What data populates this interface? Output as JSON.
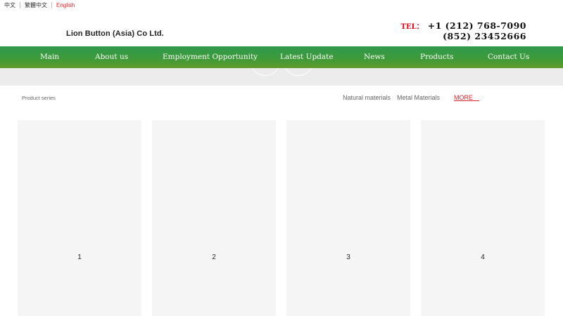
{
  "lang": {
    "items": [
      "中文",
      "繁體中文",
      "English"
    ]
  },
  "header": {
    "company": "Lion Button (Asia) Co Ltd.",
    "tel_label": "TEL：",
    "tel_1": "+1 (212) 768-7090",
    "tel_2": "(852) 23452666"
  },
  "nav": {
    "items": [
      "Main",
      "About us",
      "Employment Opportunity",
      "Latest Update",
      "News",
      "Products",
      "Contact Us"
    ]
  },
  "products": {
    "series_label": "Product series",
    "categories": [
      "Natural materials",
      "Metal Materials"
    ],
    "more": "MORE"
  },
  "cards": [
    "1",
    "2",
    "3",
    "4"
  ],
  "colors": {
    "nav_green": "#3d9a3a",
    "accent_red": "#d9252a",
    "card_bg": "#f5f5f5",
    "banner_bg": "#ececec"
  }
}
